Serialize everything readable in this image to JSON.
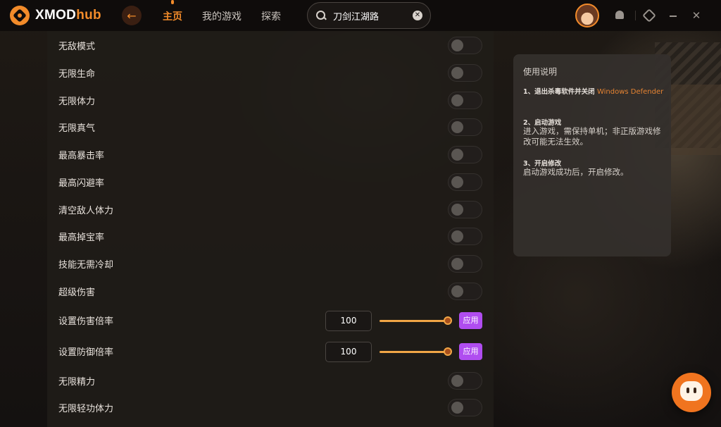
{
  "app": {
    "logo_text": "XMOD",
    "logo_text_accent": "hub"
  },
  "nav": {
    "items": [
      {
        "label": "主页",
        "active": true
      },
      {
        "label": "我的游戏",
        "active": false
      },
      {
        "label": "探索",
        "active": false
      }
    ]
  },
  "search": {
    "value": "刀剑江湖路"
  },
  "cheats": [
    {
      "label": "无敌模式",
      "type": "toggle",
      "on": false
    },
    {
      "label": "无限生命",
      "type": "toggle",
      "on": false
    },
    {
      "label": "无限体力",
      "type": "toggle",
      "on": false
    },
    {
      "label": "无限真气",
      "type": "toggle",
      "on": false
    },
    {
      "label": "最高暴击率",
      "type": "toggle",
      "on": false
    },
    {
      "label": "最高闪避率",
      "type": "toggle",
      "on": false
    },
    {
      "label": "清空敌人体力",
      "type": "toggle",
      "on": false
    },
    {
      "label": "最高掉宝率",
      "type": "toggle",
      "on": false
    },
    {
      "label": "技能无需冷却",
      "type": "toggle",
      "on": false
    },
    {
      "label": "超级伤害",
      "type": "toggle",
      "on": false
    },
    {
      "label": "设置伤害倍率",
      "type": "slider",
      "value": "100",
      "apply_label": "应用"
    },
    {
      "label": "设置防御倍率",
      "type": "slider",
      "value": "100",
      "apply_label": "应用"
    },
    {
      "label": "无限精力",
      "type": "toggle",
      "on": false
    },
    {
      "label": "无限轻功体力",
      "type": "toggle",
      "on": false
    }
  ],
  "instructions": {
    "title": "使用说明",
    "step1_title": "1、退出杀毒软件并关闭",
    "step1_link": "Windows Defender",
    "step2_title": "2、启动游戏",
    "step2_body": "进入游戏，需保持单机；非正版游戏修改可能无法生效。",
    "step3_title": "3、开启修改",
    "step3_body": "启动游戏成功后，开启修改。"
  },
  "colors": {
    "accent": "#f28b2a",
    "apply_button": "#b04df0",
    "slider": "#f1a646",
    "link": "#e58332"
  },
  "icons": {
    "back": "arrow-left-icon",
    "search": "search-icon",
    "clear": "clear-icon",
    "notifications": "bell-icon",
    "settings": "settings-icon",
    "minimize": "minimize-icon",
    "close": "close-icon",
    "chat": "chat-icon"
  }
}
